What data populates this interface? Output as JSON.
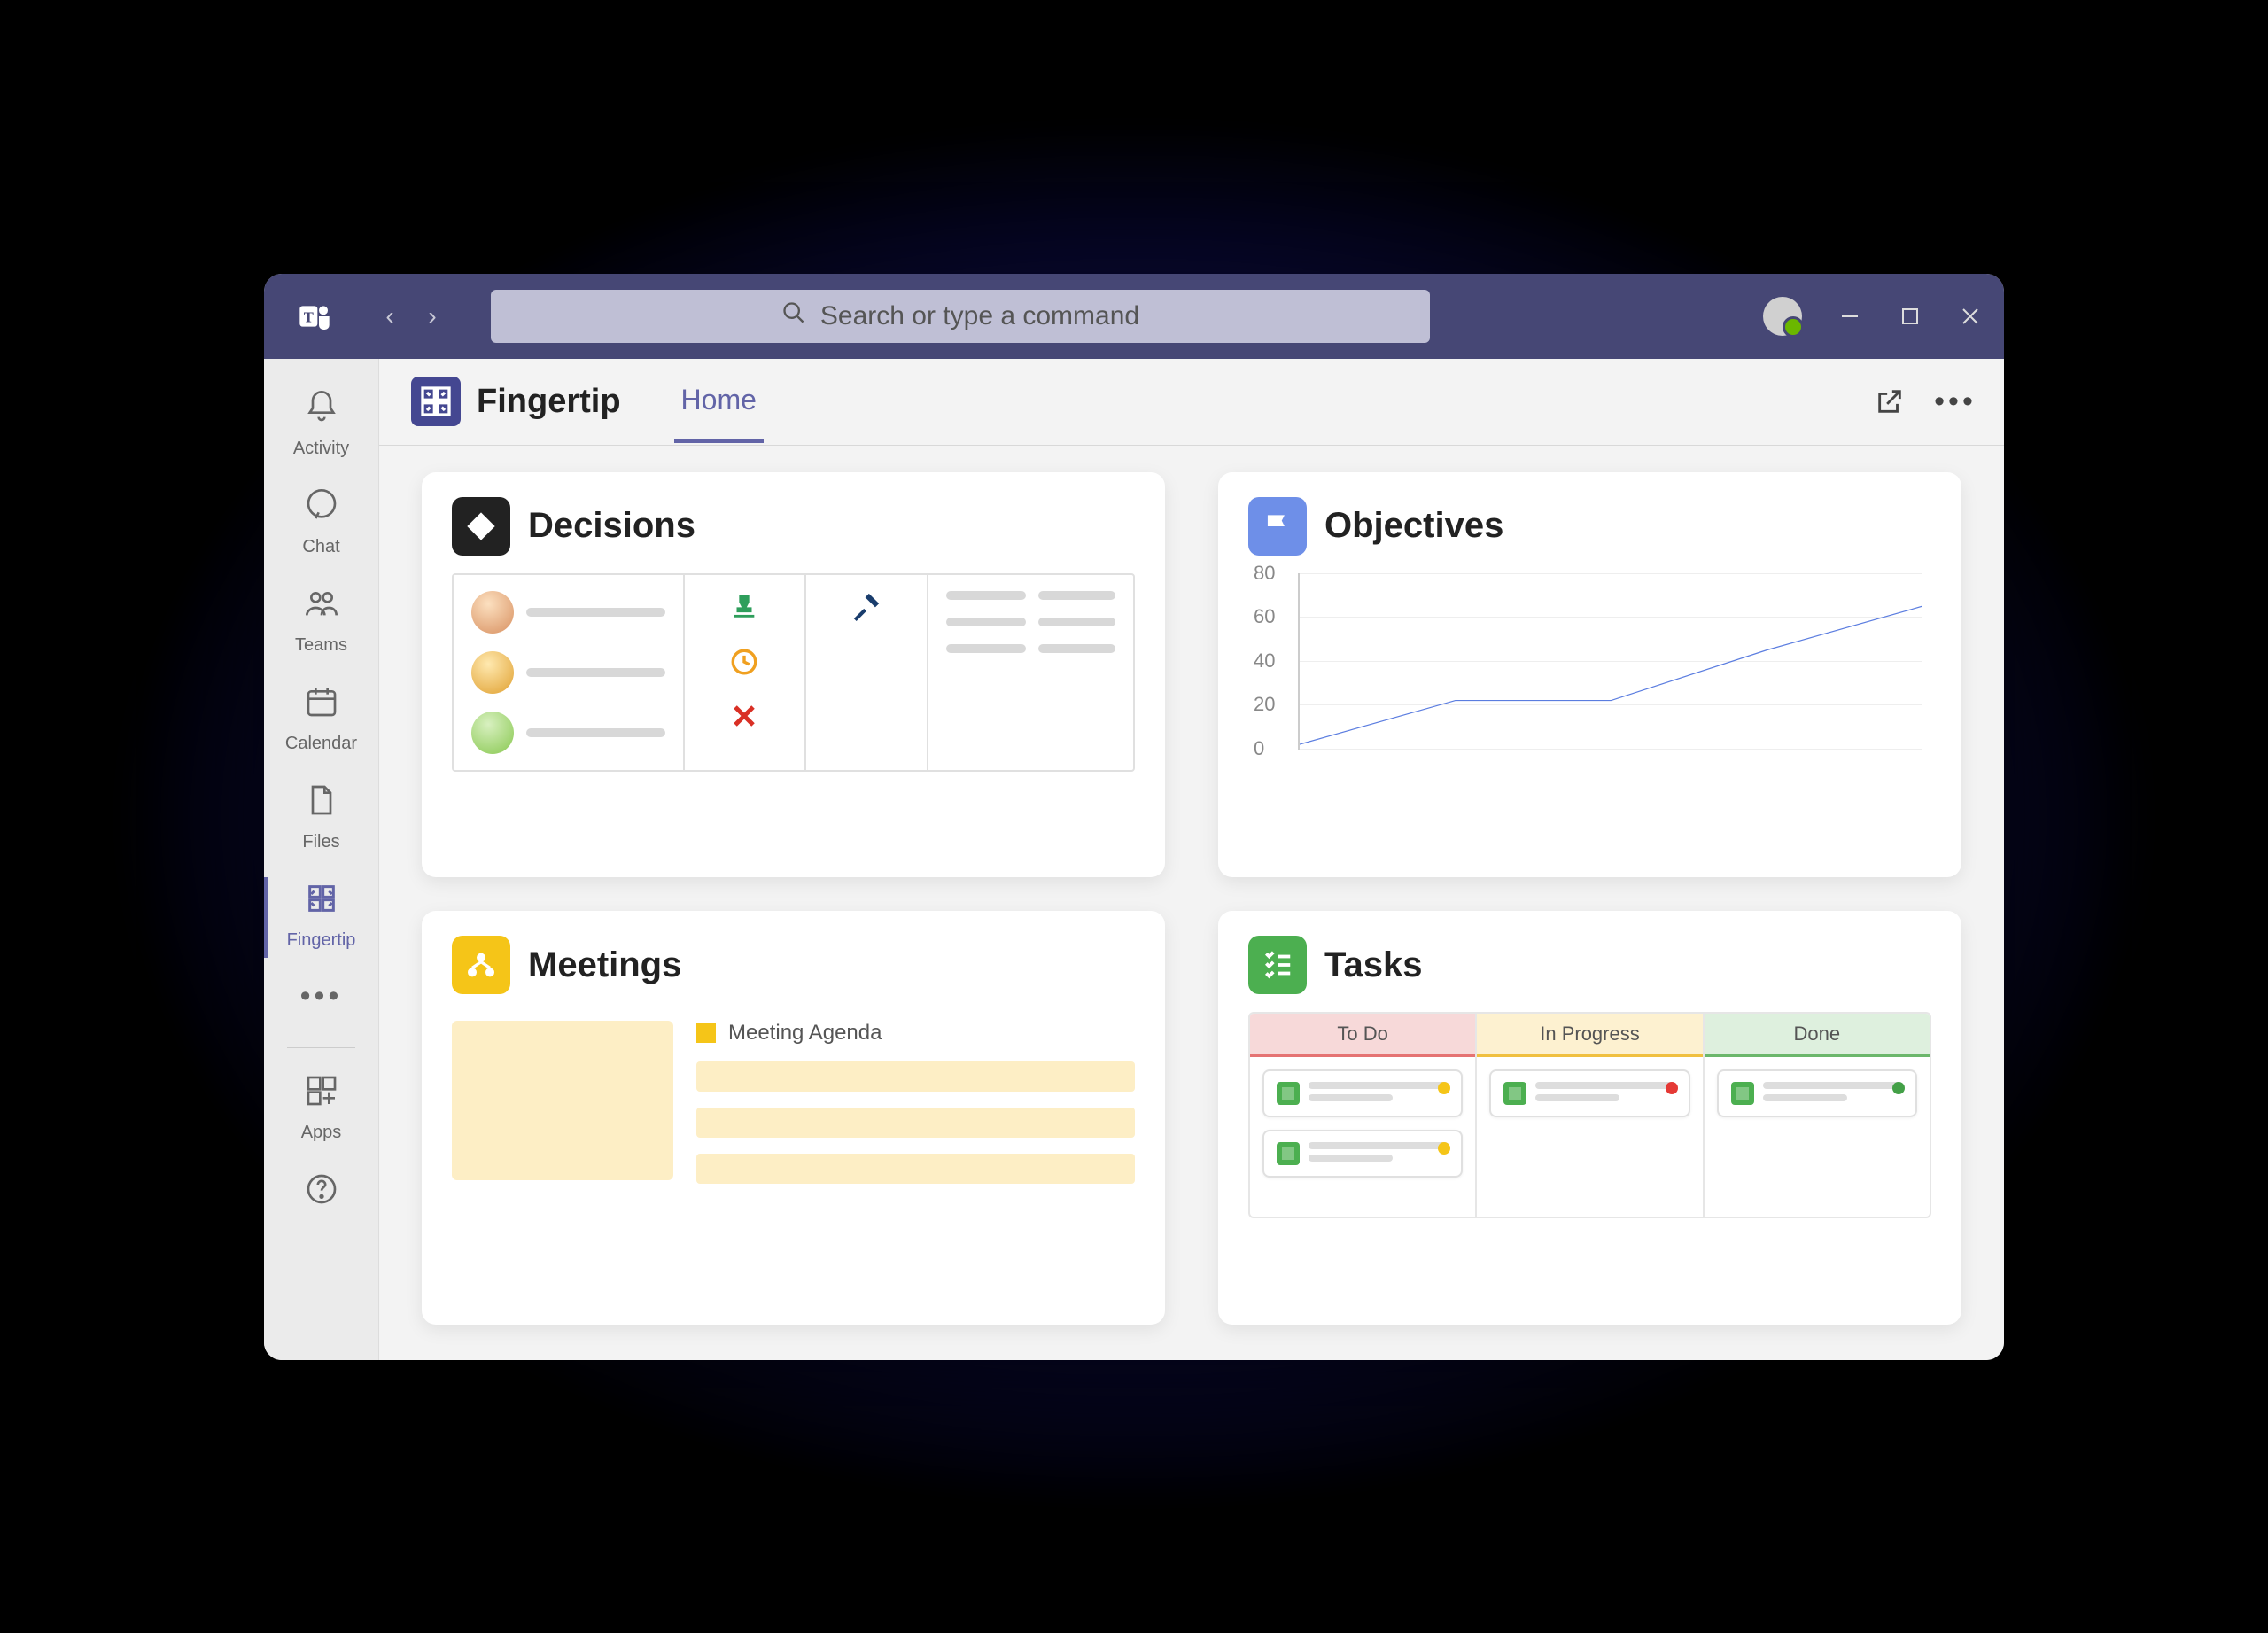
{
  "titlebar": {
    "search_placeholder": "Search or type a command"
  },
  "rail": {
    "items": [
      {
        "label": "Activity"
      },
      {
        "label": "Chat"
      },
      {
        "label": "Teams"
      },
      {
        "label": "Calendar"
      },
      {
        "label": "Files"
      },
      {
        "label": "Fingertip"
      },
      {
        "label": "Apps"
      }
    ]
  },
  "header": {
    "app_name": "Fingertip",
    "tab": "Home"
  },
  "cards": {
    "decisions": {
      "title": "Decisions"
    },
    "objectives": {
      "title": "Objectives"
    },
    "meetings": {
      "title": "Meetings",
      "agenda_label": "Meeting Agenda"
    },
    "tasks": {
      "title": "Tasks",
      "cols": {
        "todo": "To Do",
        "prog": "In Progress",
        "done": "Done"
      }
    }
  },
  "chart_data": {
    "type": "line",
    "x": [
      0,
      1,
      2,
      3,
      4
    ],
    "values": [
      2,
      22,
      22,
      45,
      65
    ],
    "ylim": [
      0,
      80
    ],
    "yticks": [
      0,
      20,
      40,
      60,
      80
    ],
    "title": "",
    "xlabel": "",
    "ylabel": ""
  },
  "colors": {
    "brand": "#464775",
    "accent": "#6264a7",
    "decisions_chip": "#222222",
    "objectives_chip": "#6e8fe8",
    "meetings_chip": "#f5c518",
    "tasks_chip": "#4caf50"
  }
}
